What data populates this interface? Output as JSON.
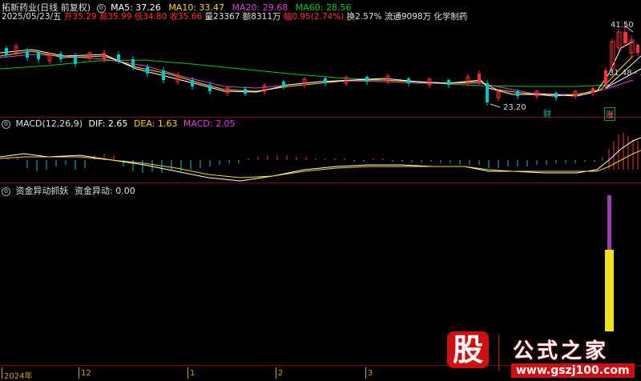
{
  "colors": {
    "up": "#ff3030",
    "down": "#00c8c8",
    "ma5": "#ffffff",
    "ma10": "#ffd700",
    "ma20": "#e040e0",
    "ma60": "#00cc00",
    "bg": "#000000",
    "separator": "#8b0000",
    "axis": "#c9a227"
  },
  "header": {
    "title": "拓新药业(日线 前复权)",
    "ma5": "MA5: 37.26",
    "ma10": "MA10: 33.47",
    "ma20": "MA20: 29.68",
    "ma60": "MA60: 28.56"
  },
  "info": {
    "date": "2025/05/23/五",
    "open": "开35.29",
    "high": "高35.99",
    "low": "低34.80",
    "close": "收35.66",
    "vol": "量23367",
    "amount": "额8311万",
    "change": "幅0.95(2.74%)",
    "turnover": "换2.57%",
    "float": "流通9098万",
    "sector": "化学制药"
  },
  "price_labels": {
    "high": "41.50",
    "low": "23.20",
    "right": "31.48 - 3"
  },
  "markers": {
    "cai": "财",
    "zhang": "涨"
  },
  "macd": {
    "label": "MACD(12,26,9)",
    "dif": "DIF: 2.65",
    "dea": "DEA: 1.63",
    "macd": "MACD: 2.05"
  },
  "fund": {
    "label": "资金异动抓妖",
    "value": "资金异动: 0.00"
  },
  "axis": {
    "year": "2024年",
    "t12": "12",
    "t1": "1",
    "t2": "2",
    "t3": "3"
  },
  "watermark": {
    "big": "股",
    "site": "公式之家",
    "url": "www.gszj100.com"
  }
}
